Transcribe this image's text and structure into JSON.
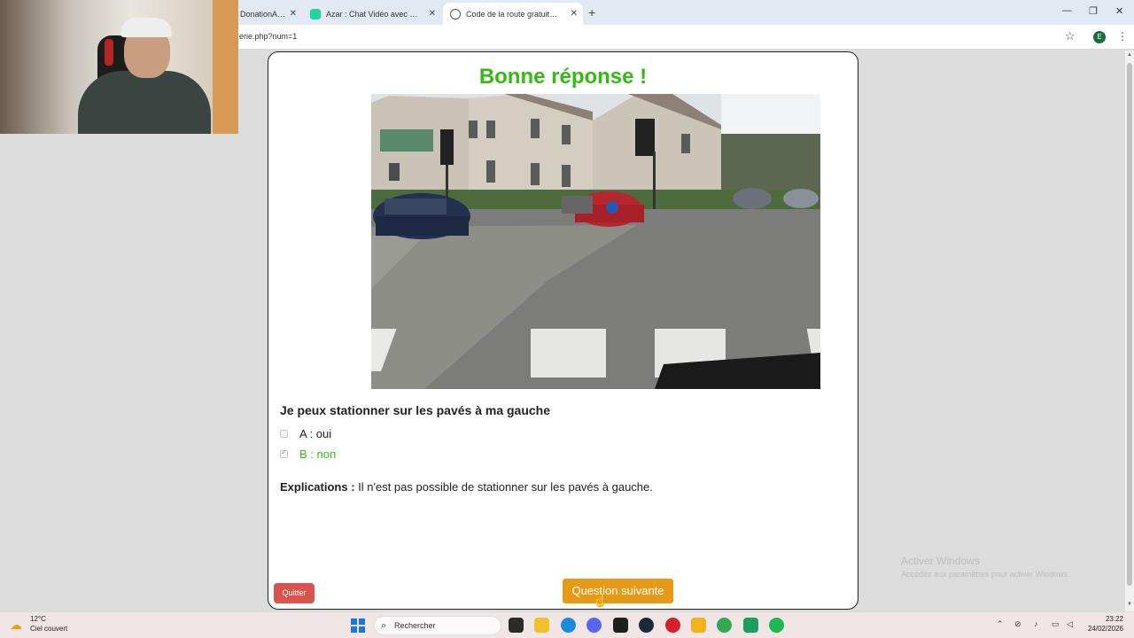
{
  "browser": {
    "tabs": [
      {
        "title": "DonationAlerts",
        "active": false
      },
      {
        "title": "Azar : Chat Vidéo avec de nouvelles personnes",
        "active": false
      },
      {
        "title": "Code de la route gratuit | Révision",
        "active": true
      }
    ],
    "new_tab_symbol": "+",
    "url": "erie.php?num=1",
    "profile_initial": "E",
    "window_controls": {
      "minimize": "—",
      "restore": "❐",
      "close": "✕"
    }
  },
  "quiz": {
    "result_title": "Bonne réponse !",
    "question": "Je peux stationner sur les pavés à ma gauche",
    "answers": [
      {
        "label": "A : oui",
        "checked": false,
        "correct": false
      },
      {
        "label": "B : non",
        "checked": true,
        "correct": true
      }
    ],
    "explanation_label": "Explications :",
    "explanation_text": " Il n'est pas possible de stationner sur les pavés à gauche.",
    "quit_label": "Quitter",
    "next_label": "Question suivante"
  },
  "watermark": {
    "line1": "Activer Windows",
    "line2": "Accédez aux paramètres pour activer Windows."
  },
  "taskbar": {
    "weather_temp": "12°C",
    "weather_desc": "Ciel couvert",
    "search_placeholder": "Rechercher",
    "time": "23:22",
    "date": "24/02/2026",
    "apps": [
      "terminal",
      "file-explorer",
      "edge",
      "discord",
      "epic-games",
      "steam",
      "app-red",
      "rockstar",
      "chrome",
      "app-green",
      "spotify"
    ]
  },
  "colors": {
    "correct_green": "#33bb11",
    "quit_red": "#d9534f",
    "next_orange": "#e69a18"
  }
}
